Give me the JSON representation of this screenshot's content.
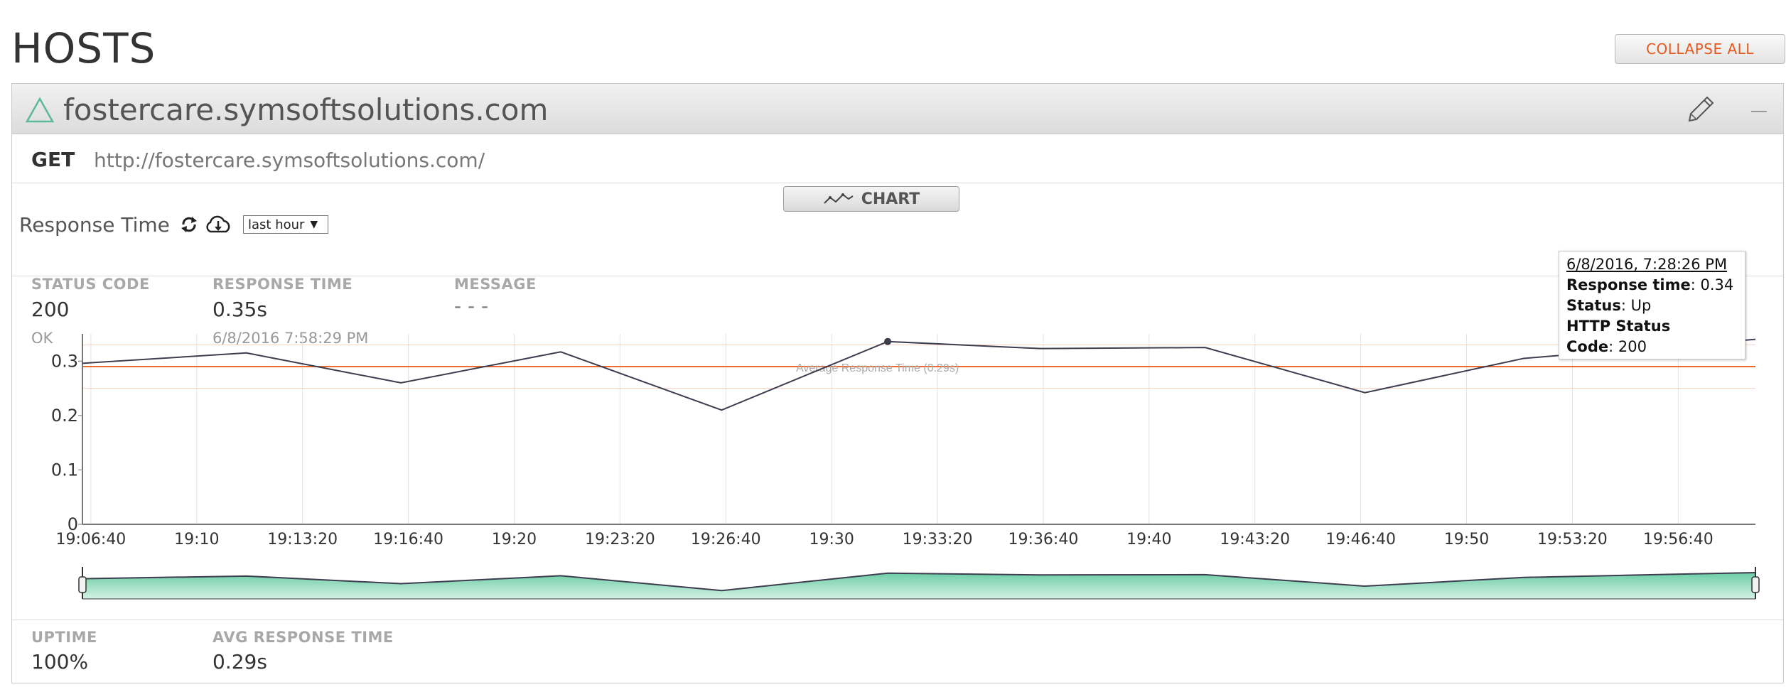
{
  "page": {
    "title": "HOSTS",
    "collapse_label": "COLLAPSE ALL"
  },
  "host": {
    "name": "fostercare.symsoftsolutions.com",
    "method": "GET",
    "url": "http://fostercare.symsoftsolutions.com/",
    "status": {
      "status_code_label": "STATUS CODE",
      "status_code": "200",
      "status_text": "OK",
      "response_time_label": "RESPONSE TIME",
      "response_time": "0.35s",
      "checked_at": "6/8/2016 7:58:29 PM",
      "message_label": "MESSAGE",
      "message": "- - -"
    },
    "chart_toggle_label": "CHART",
    "response_time_title": "Response Time",
    "range_select": "last hour",
    "footer": {
      "uptime_label": "UPTIME",
      "uptime": "100%",
      "avg_label": "AVG RESPONSE TIME",
      "avg": "0.29s"
    }
  },
  "tooltip": {
    "date": "6/8/2016, 7:28:26 PM",
    "response_time_label": "Response time",
    "response_time": "0.34",
    "status_label": "Status",
    "status": "Up",
    "http_label_1": "HTTP Status",
    "http_label_2": "Code",
    "http_code": "200"
  },
  "colors": {
    "accent": "#e7581d",
    "line": "#3c3d4f",
    "avg": "#ee6a2c",
    "navigator_fill": "#5cc59d"
  },
  "chart_data": {
    "type": "line",
    "ylim": [
      0,
      0.35
    ],
    "yticks": [
      0,
      0.1,
      0.2,
      0.3
    ],
    "ytick_labels": [
      "0",
      "0.1",
      "0.2",
      "0.3"
    ],
    "xlim": [
      384,
      3546
    ],
    "xtick_values": [
      400,
      600,
      800,
      1000,
      1200,
      1400,
      1600,
      1800,
      2000,
      2200,
      2400,
      2600,
      2800,
      3000,
      3200,
      3400
    ],
    "xtick_labels": [
      "19:06:40",
      "19:10",
      "19:13:20",
      "19:16:40",
      "19:20",
      "19:23:20",
      "19:26:40",
      "19:30",
      "19:33:20",
      "19:36:40",
      "19:40",
      "19:43:20",
      "19:46:40",
      "19:50",
      "19:53:20",
      "19:56:40"
    ],
    "series": [
      {
        "x": [
          384,
          694,
          986,
          1288,
          1592,
          1906,
          2195,
          2506,
          2808,
          3108,
          3419,
          3546
        ],
        "values": [
          0.296,
          0.315,
          0.26,
          0.317,
          0.21,
          0.336,
          0.323,
          0.325,
          0.242,
          0.305,
          0.33,
          0.34
        ]
      }
    ],
    "average": {
      "value": 0.29,
      "label": "Average Response Time (0.29s)"
    },
    "highlight_index": 5
  }
}
